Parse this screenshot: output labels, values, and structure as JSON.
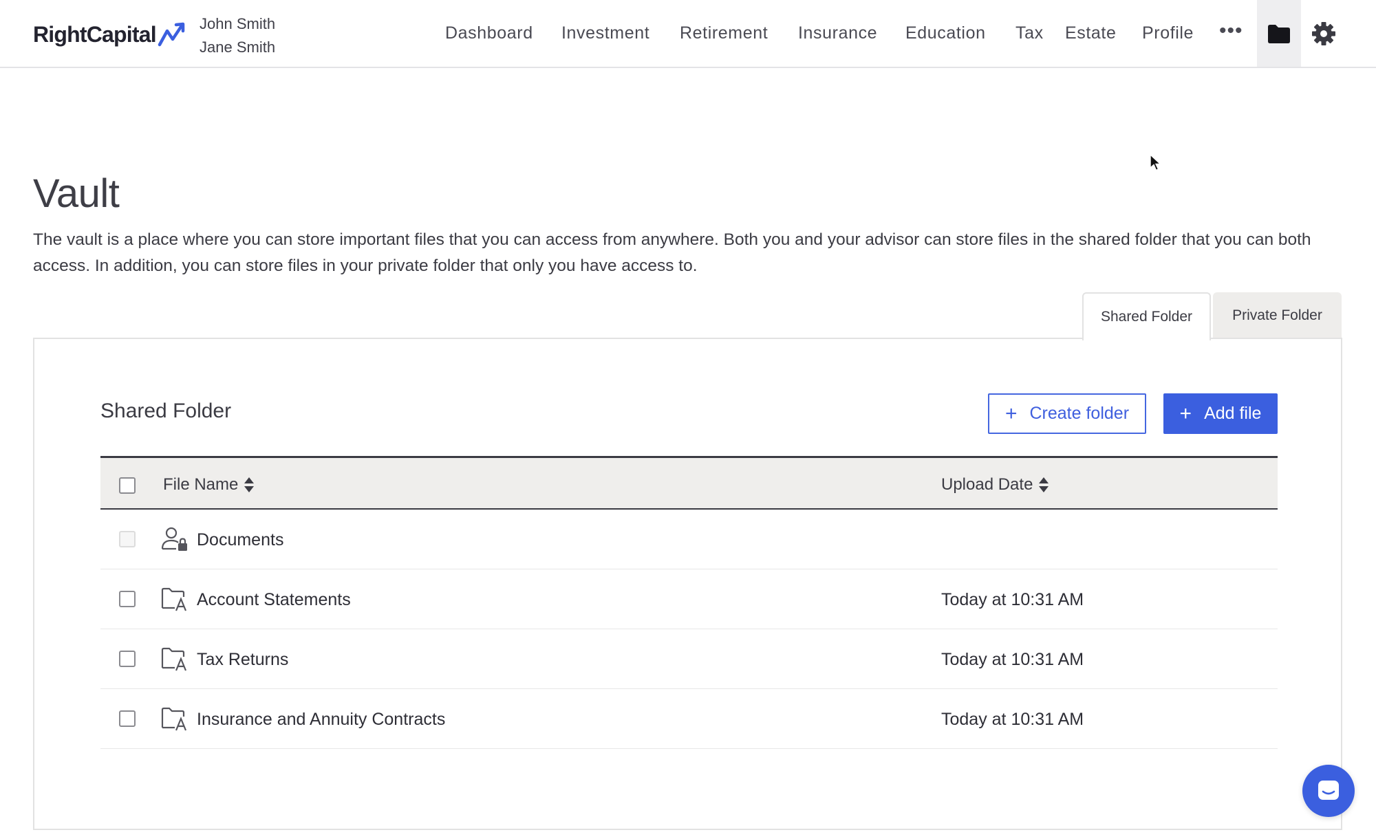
{
  "header": {
    "logo_text": "RightCapital",
    "clients": [
      "John Smith",
      "Jane Smith"
    ],
    "nav": [
      "Dashboard",
      "Investment",
      "Retirement",
      "Insurance",
      "Education",
      "Tax",
      "Estate",
      "Profile"
    ],
    "more_label": "•••",
    "icons": {
      "more": "ellipsis-icon",
      "vault": "folder-icon",
      "settings": "gear-icon"
    }
  },
  "page": {
    "title": "Vault",
    "description": "The vault is a place where you can store important files that you can access from anywhere. Both you and your advisor can store files in the shared folder that you can both access. In addition, you can store files in your private folder that only you have access to."
  },
  "tabs": [
    {
      "label": "Shared Folder",
      "active": true
    },
    {
      "label": "Private Folder",
      "active": false
    }
  ],
  "panel": {
    "title": "Shared Folder",
    "create_folder_label": "Create folder",
    "add_file_label": "Add file",
    "columns": {
      "name": "File Name",
      "date": "Upload Date"
    },
    "rows": [
      {
        "name": "Documents",
        "date": "",
        "icon": "user-lock-icon",
        "selectable": false
      },
      {
        "name": "Account Statements",
        "date": "Today at 10:31 AM",
        "icon": "folder-advisor-icon",
        "selectable": true
      },
      {
        "name": "Tax Returns",
        "date": "Today at 10:31 AM",
        "icon": "folder-advisor-icon",
        "selectable": true
      },
      {
        "name": "Insurance and Annuity Contracts",
        "date": "Today at 10:31 AM",
        "icon": "folder-advisor-icon",
        "selectable": true
      }
    ]
  },
  "colors": {
    "accent": "#3b5fdf",
    "text": "#2e2e36",
    "header_row_bg": "#efeeec",
    "active_nav_bg": "#eeeef0"
  }
}
